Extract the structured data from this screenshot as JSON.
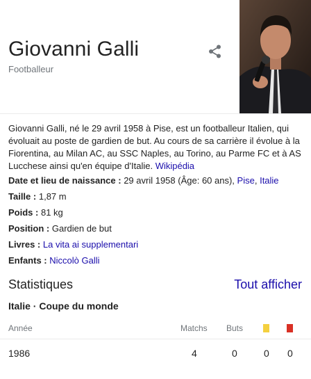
{
  "header": {
    "title": "Giovanni Galli",
    "subtitle": "Footballeur",
    "share_icon": "share-icon",
    "photo_icon": "person-photo"
  },
  "description": {
    "text": "Giovanni Galli, né le 29 avril 1958 à Pise, est un footballeur Italien, qui évoluait au poste de gardien de but. Au cours de sa carrière il évolue à la Fiorentina, au Milan AC, au SSC Naples, au Torino, au Parme FC et à AS Lucchese ainsi qu'en équipe d'Italie.",
    "source": "Wikipédia"
  },
  "facts": {
    "birth_label": "Date et lieu de naissance",
    "birth_value": "29 avril 1958 (Âge: 60 ans),",
    "birth_place_1": "Pise",
    "birth_place_2": "Italie",
    "height_label": "Taille",
    "height_value": "1,87 m",
    "weight_label": "Poids",
    "weight_value": "81 kg",
    "position_label": "Position",
    "position_value": "Gardien de but",
    "books_label": "Livres",
    "books_value": "La vita ai supplementari",
    "children_label": "Enfants",
    "children_value": "Niccolò Galli"
  },
  "stats": {
    "title": "Statistiques",
    "show_all": "Tout afficher",
    "subtitle": "Italie · Coupe du monde",
    "columns": {
      "year": "Année",
      "matches": "Matchs",
      "goals": "Buts"
    },
    "yellow_color": "#f4d03f",
    "red_color": "#d93025",
    "rows": [
      {
        "year": "1986",
        "matches": "4",
        "goals": "0",
        "yellow": "0",
        "red": "0"
      }
    ]
  }
}
